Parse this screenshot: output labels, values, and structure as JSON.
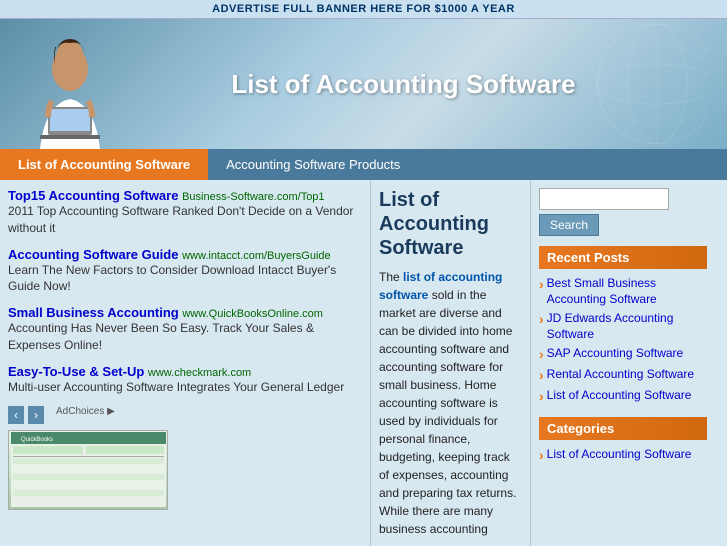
{
  "topAd": {
    "text": "ADVERTISE FULL BANNER HERE FOR $1000 A YEAR"
  },
  "header": {
    "title": "List of Accounting Software"
  },
  "navTabs": [
    {
      "label": "List of Accounting Software",
      "active": true
    },
    {
      "label": "Accounting Software Products",
      "active": false
    }
  ],
  "ads": [
    {
      "title": "Top15 Accounting Software",
      "titleUrl": "#",
      "subtitle": "Business-Software.com/Top1",
      "desc": "2011 Top Accounting Software Ranked Don't Decide on a Vendor without it"
    },
    {
      "title": "Accounting Software Guide",
      "titleUrl": "#",
      "subtitle": "www.intacct.com/BuyersGuide",
      "desc": "Learn The New Factors to Consider Download Intacct Buyer's Guide Now!"
    },
    {
      "title": "Small Business Accounting",
      "titleUrl": "#",
      "subtitle": "www.QuickBooksOnline.com",
      "desc": "Accounting Has Never Been So Easy. Track Your Sales & Expenses Online!"
    },
    {
      "title": "Easy-To-Use & Set-Up",
      "titleUrl": "#",
      "subtitle": "www.checkmark.com",
      "desc": "Multi-user Accounting Software Integrates Your General Ledger"
    }
  ],
  "adNavPrev": "‹",
  "adNavNext": "›",
  "adChoices": "AdChoices ▶",
  "screenshotAlt": "Accounting Software Screenshot",
  "mainContent": {
    "title": "List of\nAccounting\nSoftware",
    "bodyHighlight": "list of accounting software",
    "body": "The list of accounting software sold in the market are diverse and can be divided into home accounting software and accounting software for small business. Home accounting software is used by individuals for personal finance, budgeting, keeping track of expenses, accounting and preparing tax returns. While there are many business accounting"
  },
  "search": {
    "placeholder": "",
    "buttonLabel": "Search"
  },
  "recentPosts": {
    "title": "Recent Posts",
    "links": [
      "Best Small Business Accounting Software",
      "JD Edwards Accounting Software",
      "SAP Accounting Software",
      "Rental Accounting Software",
      "List of Accounting Software"
    ]
  },
  "categories": {
    "title": "Categories",
    "links": [
      "List of Accounting Software"
    ]
  }
}
